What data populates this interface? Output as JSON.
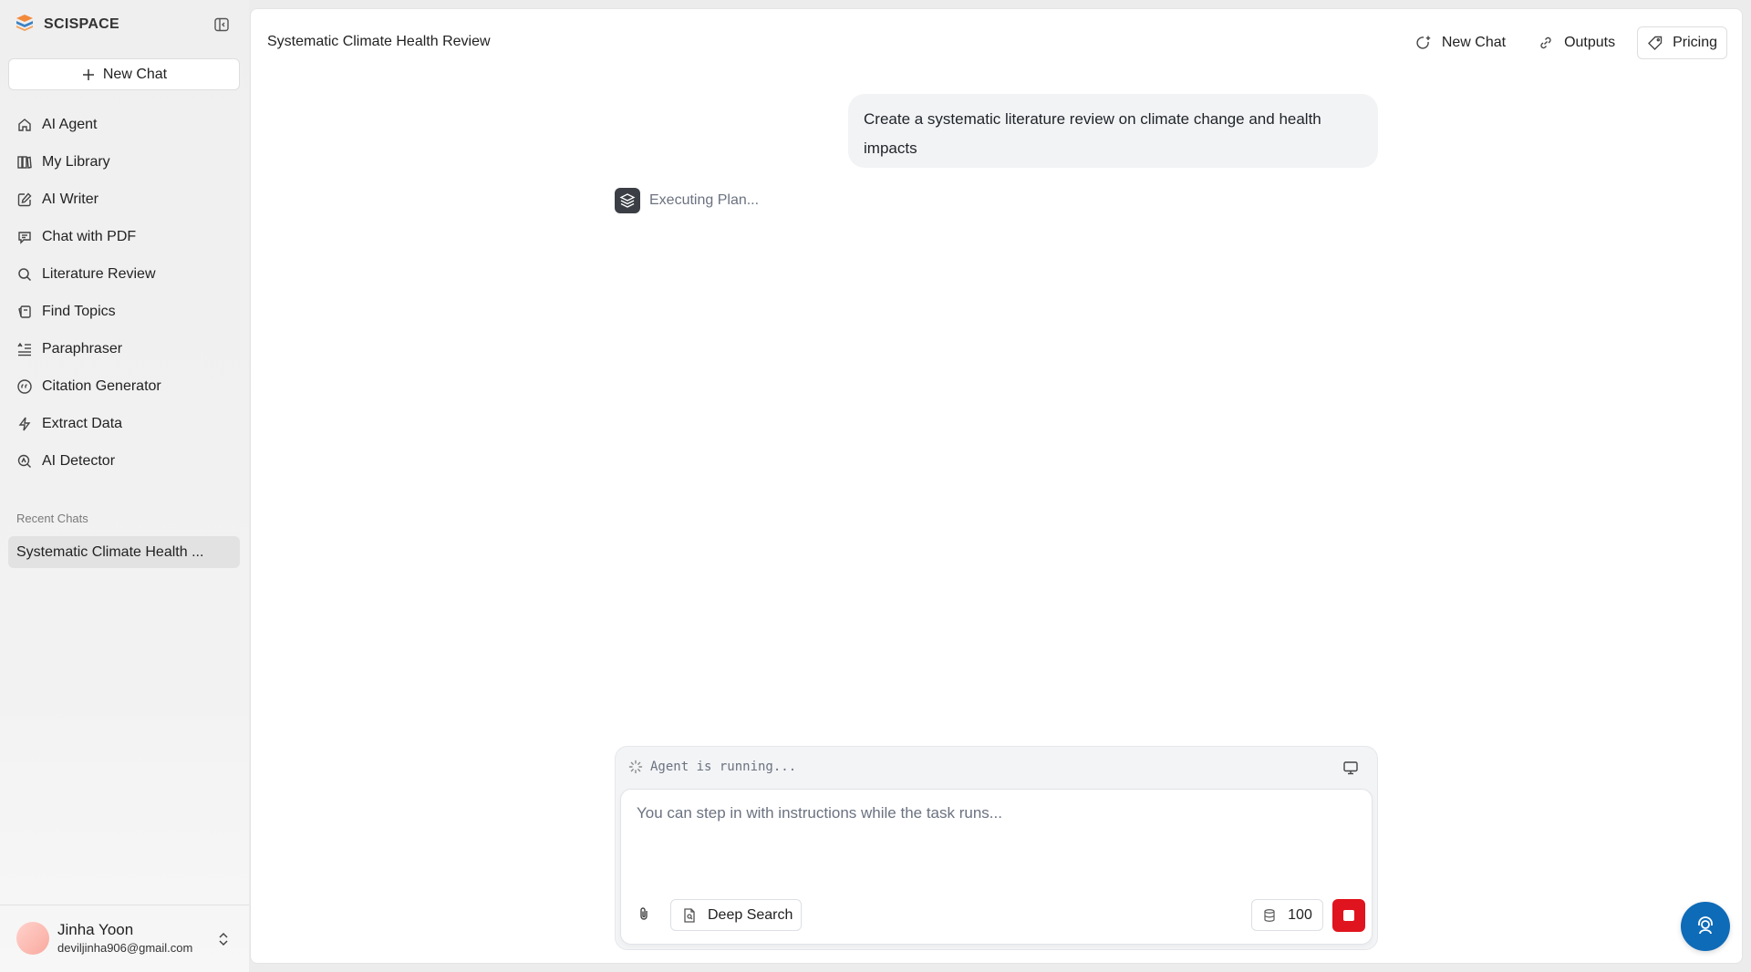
{
  "brand": {
    "name": "SCISPACE"
  },
  "sidebar": {
    "new_chat_label": "New Chat",
    "items": [
      {
        "label": "AI Agent",
        "icon": "home-icon"
      },
      {
        "label": "My Library",
        "icon": "library-icon"
      },
      {
        "label": "AI Writer",
        "icon": "edit-icon"
      },
      {
        "label": "Chat with PDF",
        "icon": "chat-bubble-icon"
      },
      {
        "label": "Literature Review",
        "icon": "search-icon"
      },
      {
        "label": "Find Topics",
        "icon": "topics-icon"
      },
      {
        "label": "Paraphraser",
        "icon": "paraphrase-icon"
      },
      {
        "label": "Citation Generator",
        "icon": "quote-icon"
      },
      {
        "label": "Extract Data",
        "icon": "lightning-icon"
      },
      {
        "label": "AI Detector",
        "icon": "detector-icon"
      }
    ],
    "recent_label": "Recent Chats",
    "recent_items": [
      "Systematic Climate Health ..."
    ]
  },
  "user": {
    "name": "Jinha Yoon",
    "email": "deviljinha906@gmail.com"
  },
  "header": {
    "title": "Systematic Climate Health Review",
    "new_chat_label": "New Chat",
    "outputs_label": "Outputs",
    "pricing_label": "Pricing"
  },
  "conversation": {
    "user_message": "Create a systematic literature review on climate change and health impacts",
    "status_text": "Executing Plan..."
  },
  "composer": {
    "agent_status": "Agent is running...",
    "placeholder": "You can step in with instructions while the task runs...",
    "deep_search_label": "Deep Search",
    "credits": "100"
  },
  "colors": {
    "stop": "#e0141e",
    "help": "#0e6bb8",
    "brand_orange": "#f28a3c",
    "brand_blue": "#3b82c4"
  }
}
